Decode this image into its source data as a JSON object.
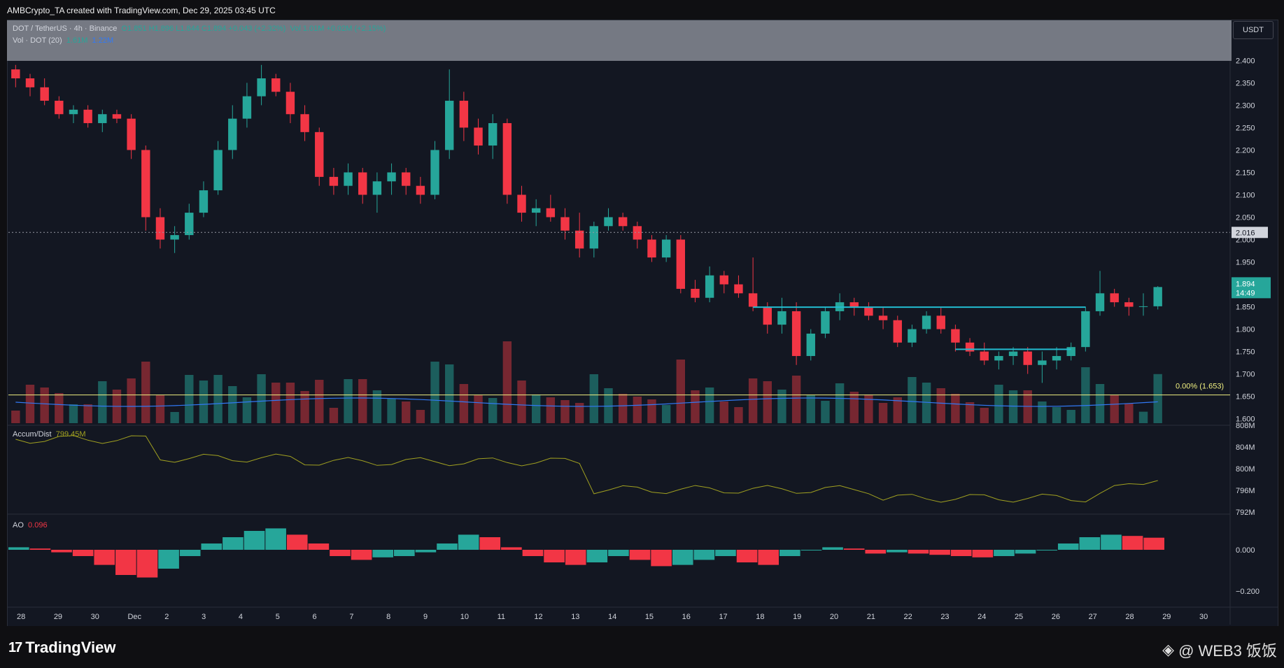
{
  "header": {
    "publisher_line": "AMBCrypto_TA created with TradingView.com, Dec 29, 2025 03:45 UTC"
  },
  "legend": {
    "symbol": "DOT / TetherUS · 4h · Binance",
    "ohlc": "O1.851 H1.896 L1.844 C1.894 +0.043 (+2.32%)",
    "volume": "Vol 1.01M +0.02M (+2.15%)",
    "vol_indicator": "Vol · DOT (20)",
    "vol_value1": "1.61M",
    "vol_value2": "1.22M"
  },
  "currency_badge": "USDT",
  "price_axis": {
    "labels": [
      "2.400",
      "2.350",
      "2.300",
      "2.250",
      "2.200",
      "2.150",
      "2.100",
      "2.050",
      "2.000",
      "1.950",
      "1.900",
      "1.850",
      "1.800",
      "1.750",
      "1.700",
      "1.650",
      "1.600"
    ],
    "dotted_level": "2.016",
    "last_price": "1.894",
    "countdown": "14:49",
    "fib_label": "0.00% (1.653)"
  },
  "accum_pane": {
    "title": "Accum/Dist",
    "value": "799.45M",
    "labels": [
      "808M",
      "804M",
      "800M",
      "796M",
      "792M"
    ]
  },
  "ao_pane": {
    "title": "AO",
    "value": "0.096",
    "labels": [
      "0.000",
      "−0.200"
    ]
  },
  "time_axis": [
    "28",
    "29",
    "30",
    "Dec",
    "2",
    "3",
    "4",
    "5",
    "6",
    "7",
    "8",
    "9",
    "10",
    "11",
    "12",
    "13",
    "14",
    "15",
    "16",
    "17",
    "18",
    "19",
    "20",
    "21",
    "22",
    "23",
    "24",
    "25",
    "26",
    "27",
    "28",
    "29",
    "30"
  ],
  "footer": {
    "brand": "TradingView",
    "watermark": "@ WEB3 饭饭"
  },
  "colors": {
    "up": "#26a69a",
    "down": "#f23645",
    "line_blue": "#3179f5",
    "accum": "#a0a020",
    "fib": "#f0f080",
    "level_line": "#22bcd0",
    "panel": "#131722"
  },
  "chart_data": {
    "type": "candlestick",
    "interval": "4h",
    "ylim": [
      1.59,
      2.41
    ],
    "candles": [
      [
        2.38,
        2.39,
        2.34,
        2.36
      ],
      [
        2.36,
        2.37,
        2.32,
        2.34
      ],
      [
        2.34,
        2.36,
        2.3,
        2.31
      ],
      [
        2.31,
        2.32,
        2.27,
        2.28
      ],
      [
        2.28,
        2.3,
        2.26,
        2.29
      ],
      [
        2.29,
        2.3,
        2.25,
        2.26
      ],
      [
        2.26,
        2.29,
        2.24,
        2.28
      ],
      [
        2.28,
        2.29,
        2.26,
        2.27
      ],
      [
        2.27,
        2.28,
        2.18,
        2.2
      ],
      [
        2.2,
        2.21,
        2.02,
        2.05
      ],
      [
        2.05,
        2.07,
        1.98,
        2.0
      ],
      [
        2.0,
        2.03,
        1.97,
        2.01
      ],
      [
        2.01,
        2.08,
        2.0,
        2.06
      ],
      [
        2.06,
        2.13,
        2.05,
        2.11
      ],
      [
        2.11,
        2.22,
        2.1,
        2.2
      ],
      [
        2.2,
        2.3,
        2.18,
        2.27
      ],
      [
        2.27,
        2.35,
        2.25,
        2.32
      ],
      [
        2.32,
        2.39,
        2.3,
        2.36
      ],
      [
        2.36,
        2.37,
        2.32,
        2.33
      ],
      [
        2.33,
        2.35,
        2.26,
        2.28
      ],
      [
        2.28,
        2.3,
        2.22,
        2.24
      ],
      [
        2.24,
        2.25,
        2.12,
        2.14
      ],
      [
        2.14,
        2.16,
        2.1,
        2.12
      ],
      [
        2.12,
        2.17,
        2.1,
        2.15
      ],
      [
        2.15,
        2.16,
        2.08,
        2.1
      ],
      [
        2.1,
        2.15,
        2.06,
        2.13
      ],
      [
        2.13,
        2.17,
        2.1,
        2.15
      ],
      [
        2.15,
        2.16,
        2.1,
        2.12
      ],
      [
        2.12,
        2.14,
        2.08,
        2.1
      ],
      [
        2.1,
        2.22,
        2.09,
        2.2
      ],
      [
        2.2,
        2.38,
        2.18,
        2.31
      ],
      [
        2.31,
        2.33,
        2.22,
        2.25
      ],
      [
        2.25,
        2.27,
        2.19,
        2.21
      ],
      [
        2.21,
        2.28,
        2.18,
        2.26
      ],
      [
        2.26,
        2.27,
        2.08,
        2.1
      ],
      [
        2.1,
        2.12,
        2.04,
        2.06
      ],
      [
        2.06,
        2.09,
        2.03,
        2.07
      ],
      [
        2.07,
        2.1,
        2.04,
        2.05
      ],
      [
        2.05,
        2.07,
        2.0,
        2.02
      ],
      [
        2.02,
        2.06,
        1.96,
        1.98
      ],
      [
        1.98,
        2.04,
        1.96,
        2.03
      ],
      [
        2.03,
        2.07,
        2.02,
        2.05
      ],
      [
        2.05,
        2.06,
        2.02,
        2.03
      ],
      [
        2.03,
        2.04,
        1.98,
        2.0
      ],
      [
        2.0,
        2.01,
        1.95,
        1.96
      ],
      [
        1.96,
        2.01,
        1.95,
        2.0
      ],
      [
        2.0,
        2.01,
        1.88,
        1.89
      ],
      [
        1.89,
        1.91,
        1.86,
        1.87
      ],
      [
        1.87,
        1.94,
        1.86,
        1.92
      ],
      [
        1.92,
        1.93,
        1.88,
        1.9
      ],
      [
        1.9,
        1.92,
        1.87,
        1.88
      ],
      [
        1.88,
        1.96,
        1.84,
        1.85
      ],
      [
        1.85,
        1.86,
        1.79,
        1.81
      ],
      [
        1.81,
        1.87,
        1.79,
        1.84
      ],
      [
        1.84,
        1.86,
        1.72,
        1.74
      ],
      [
        1.74,
        1.8,
        1.73,
        1.79
      ],
      [
        1.79,
        1.85,
        1.78,
        1.84
      ],
      [
        1.84,
        1.88,
        1.82,
        1.86
      ],
      [
        1.86,
        1.87,
        1.83,
        1.85
      ],
      [
        1.85,
        1.86,
        1.82,
        1.83
      ],
      [
        1.83,
        1.85,
        1.8,
        1.82
      ],
      [
        1.82,
        1.83,
        1.76,
        1.77
      ],
      [
        1.77,
        1.81,
        1.76,
        1.8
      ],
      [
        1.8,
        1.84,
        1.79,
        1.83
      ],
      [
        1.83,
        1.85,
        1.79,
        1.8
      ],
      [
        1.8,
        1.81,
        1.75,
        1.77
      ],
      [
        1.77,
        1.78,
        1.74,
        1.75
      ],
      [
        1.75,
        1.77,
        1.72,
        1.73
      ],
      [
        1.73,
        1.75,
        1.71,
        1.74
      ],
      [
        1.74,
        1.76,
        1.72,
        1.75
      ],
      [
        1.75,
        1.76,
        1.7,
        1.72
      ],
      [
        1.72,
        1.75,
        1.68,
        1.73
      ],
      [
        1.73,
        1.76,
        1.71,
        1.74
      ],
      [
        1.74,
        1.77,
        1.73,
        1.76
      ],
      [
        1.76,
        1.85,
        1.75,
        1.84
      ],
      [
        1.84,
        1.93,
        1.83,
        1.88
      ],
      [
        1.88,
        1.89,
        1.85,
        1.86
      ],
      [
        1.86,
        1.87,
        1.83,
        1.85
      ],
      [
        1.85,
        1.88,
        1.83,
        1.851
      ],
      [
        1.851,
        1.896,
        1.844,
        1.894
      ]
    ],
    "ao_values": [
      0.02,
      0.01,
      -0.02,
      -0.05,
      -0.12,
      -0.2,
      -0.22,
      -0.15,
      -0.05,
      0.05,
      0.1,
      0.15,
      0.17,
      0.12,
      0.05,
      -0.05,
      -0.08,
      -0.06,
      -0.05,
      -0.02,
      0.05,
      0.12,
      0.1,
      0.02,
      -0.05,
      -0.1,
      -0.12,
      -0.1,
      -0.05,
      -0.08,
      -0.13,
      -0.12,
      -0.08,
      -0.05,
      -0.1,
      -0.12,
      -0.05,
      0.0,
      0.02,
      0.01,
      -0.03,
      -0.02,
      -0.03,
      -0.04,
      -0.05,
      -0.06,
      -0.05,
      -0.03,
      0.0,
      0.05,
      0.1,
      0.12,
      0.11,
      0.096
    ]
  }
}
